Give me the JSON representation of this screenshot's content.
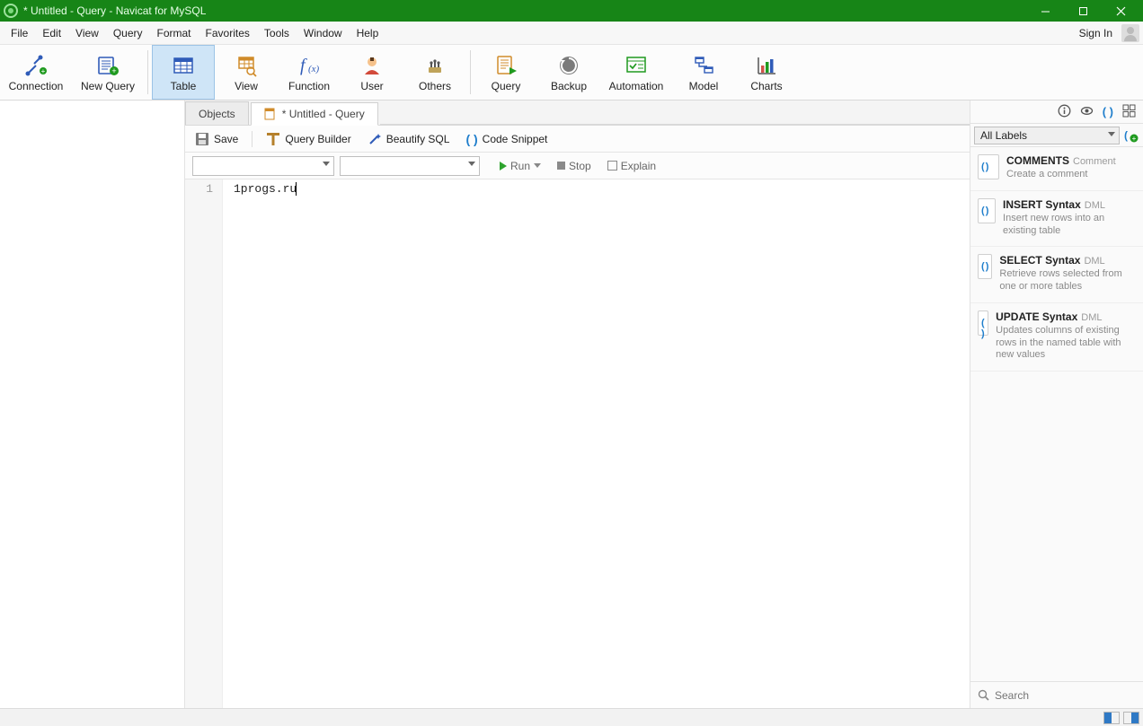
{
  "title": "* Untitled - Query - Navicat for MySQL",
  "menubar": [
    "File",
    "Edit",
    "View",
    "Query",
    "Format",
    "Favorites",
    "Tools",
    "Window",
    "Help"
  ],
  "signin_label": "Sign In",
  "toolbar": {
    "connection": "Connection",
    "new_query": "New Query",
    "table": "Table",
    "view": "View",
    "function": "Function",
    "user": "User",
    "others": "Others",
    "query": "Query",
    "backup": "Backup",
    "automation": "Automation",
    "model": "Model",
    "charts": "Charts"
  },
  "tabs": {
    "objects": "Objects",
    "untitled": "* Untitled - Query"
  },
  "querybar": {
    "save": "Save",
    "query_builder": "Query Builder",
    "beautify": "Beautify SQL",
    "code_snippet": "Code Snippet"
  },
  "runbar": {
    "run": "Run",
    "stop": "Stop",
    "explain": "Explain"
  },
  "editor": {
    "line_no": "1",
    "text": "1progs.ru"
  },
  "labels_combo": "All Labels",
  "snippets": [
    {
      "title": "COMMENTS",
      "sub": "Comment",
      "desc": "Create a comment"
    },
    {
      "title": "INSERT Syntax",
      "sub": "DML",
      "desc": "Insert new rows into an existing table"
    },
    {
      "title": "SELECT Syntax",
      "sub": "DML",
      "desc": "Retrieve rows selected from one or more tables"
    },
    {
      "title": "UPDATE Syntax",
      "sub": "DML",
      "desc": "Updates columns of existing rows in the named table with new values"
    }
  ],
  "search_placeholder": "Search"
}
